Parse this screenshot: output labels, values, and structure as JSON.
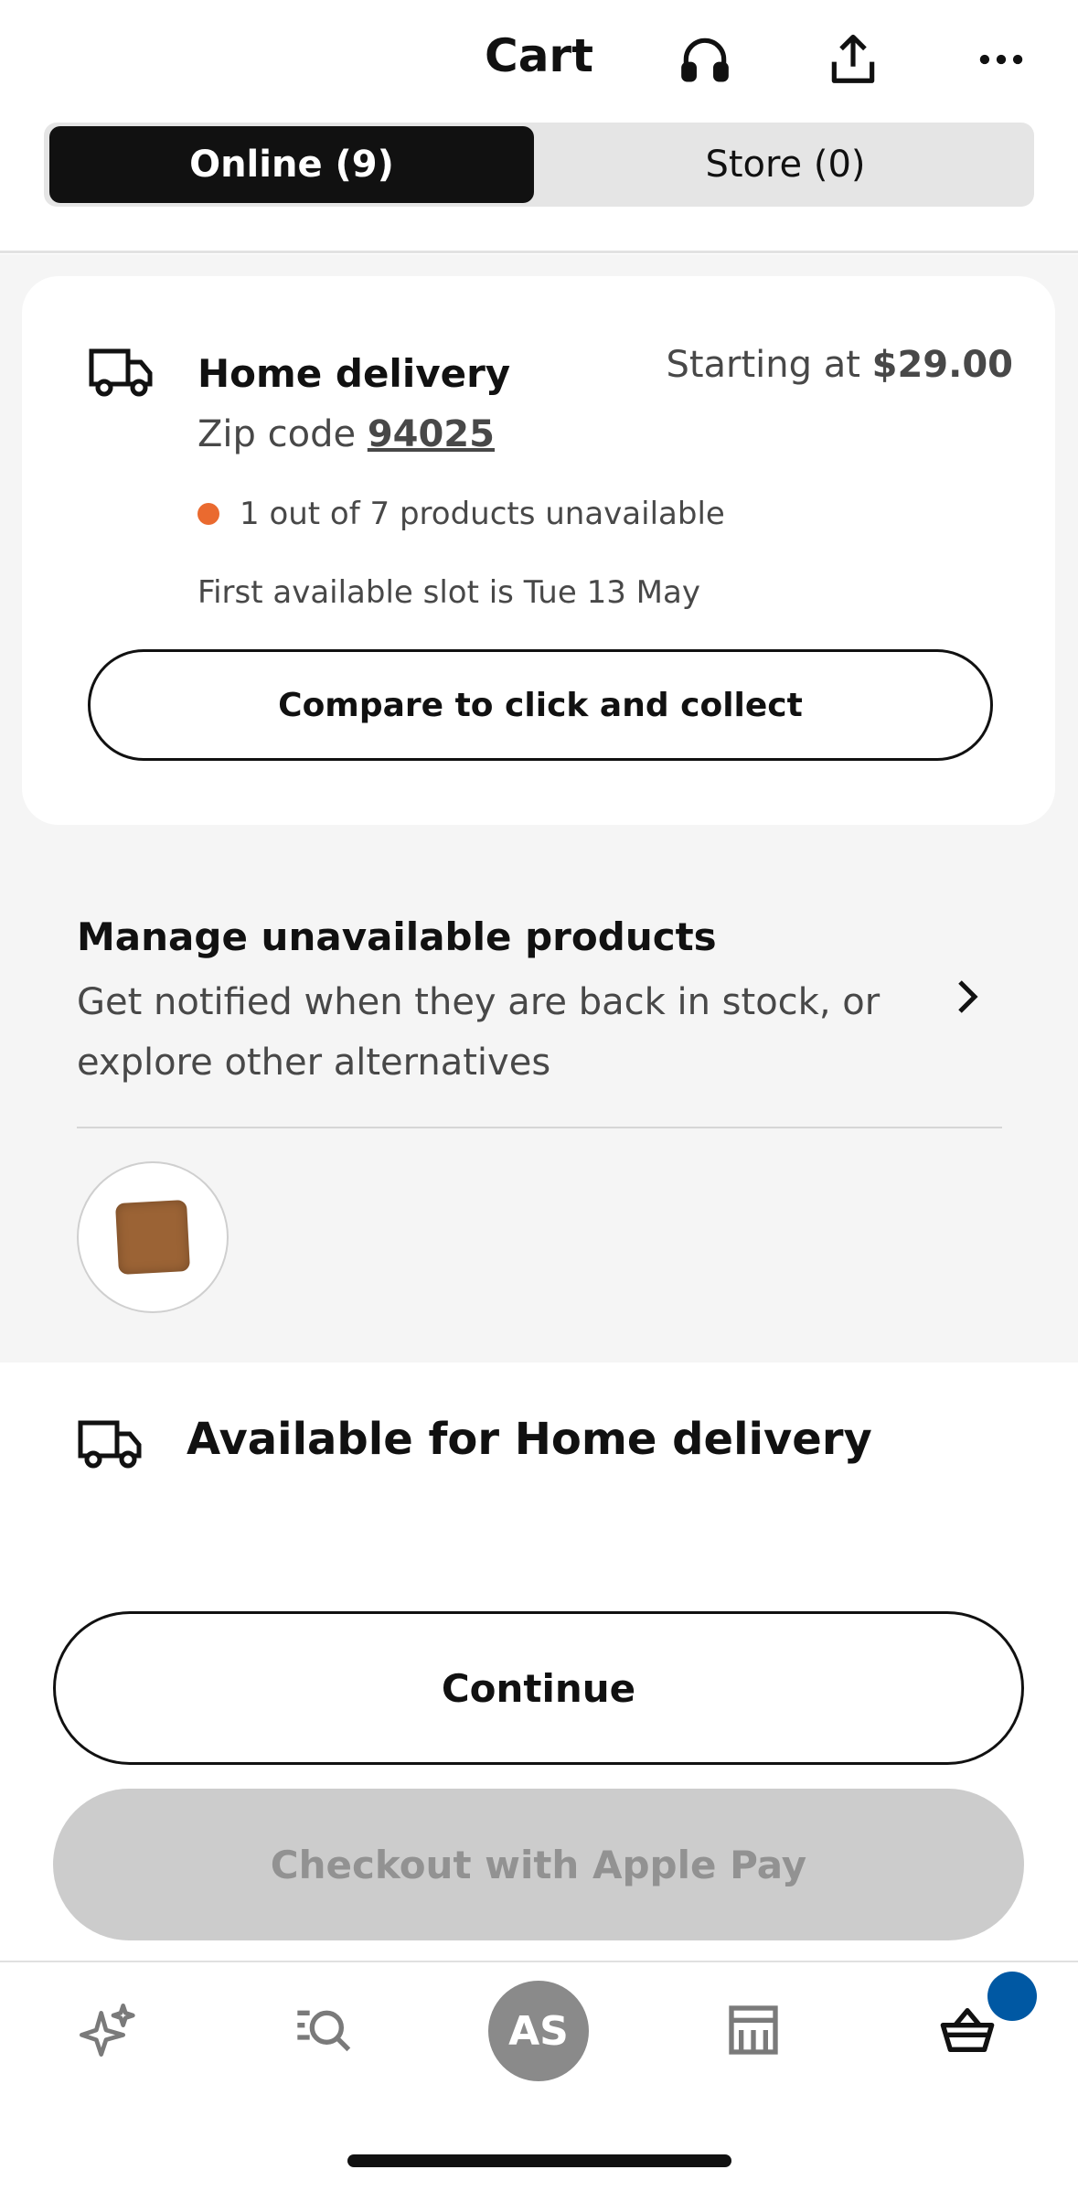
{
  "header": {
    "title": "Cart",
    "icons": [
      "headset-icon",
      "share-icon",
      "more-icon"
    ]
  },
  "tabs": [
    {
      "label": "Online (9)",
      "selected": true
    },
    {
      "label": "Store (0)",
      "selected": false
    }
  ],
  "delivery_card": {
    "title": "Home delivery",
    "price_prefix": "Starting at",
    "price": "$29.00",
    "zip_label": "Zip code",
    "zip_value": "94025",
    "status_text": "1 out of 7 products unavailable",
    "status_color": "#ea6a2f",
    "slot_text": "First available slot is Tue 13 May",
    "compare_button": "Compare to click and collect"
  },
  "manage_unavailable": {
    "title": "Manage unavailable products",
    "subtitle": "Get notified when they are back in stock, or explore other alternatives",
    "thumbnail": "brown-cushion"
  },
  "available_section": {
    "title": "Available for Home delivery"
  },
  "actions": {
    "continue": "Continue",
    "apple_pay": "Checkout with Apple Pay"
  },
  "bottom_nav": {
    "items": [
      "sparkle-icon",
      "search-icon",
      "avatar",
      "store-icon",
      "cart-icon"
    ],
    "avatar_initials": "AS",
    "badge_color": "#0058a3"
  },
  "colors": {
    "primary": "#111111",
    "accent_blue": "#0058a3",
    "warning": "#ea6a2f"
  }
}
